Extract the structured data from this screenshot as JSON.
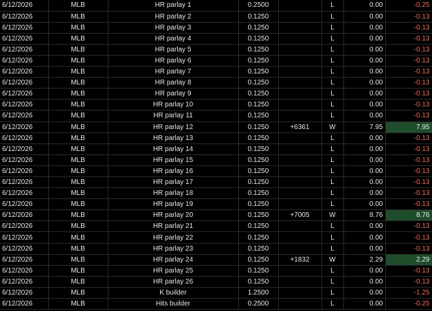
{
  "colors": {
    "background": "#000000",
    "text": "#e8e8e8",
    "negative": "#f06b5d",
    "win_highlight": "#1e4d2b",
    "gridline": "#2b2b2b"
  },
  "rows": [
    {
      "date": "6/12/2026",
      "league": "MLB",
      "bet": "HR parlay 1",
      "stake": "0.2500",
      "odds": "",
      "result": "L",
      "payout": "0.00",
      "net": "-0.25",
      "win": false
    },
    {
      "date": "6/12/2026",
      "league": "MLB",
      "bet": "HR parlay 2",
      "stake": "0.1250",
      "odds": "",
      "result": "L",
      "payout": "0.00",
      "net": "-0.13",
      "win": false
    },
    {
      "date": "6/12/2026",
      "league": "MLB",
      "bet": "HR parlay 3",
      "stake": "0.1250",
      "odds": "",
      "result": "L",
      "payout": "0.00",
      "net": "-0.13",
      "win": false
    },
    {
      "date": "6/12/2026",
      "league": "MLB",
      "bet": "HR parlay 4",
      "stake": "0.1250",
      "odds": "",
      "result": "L",
      "payout": "0.00",
      "net": "-0.13",
      "win": false
    },
    {
      "date": "6/12/2026",
      "league": "MLB",
      "bet": "HR parlay 5",
      "stake": "0.1250",
      "odds": "",
      "result": "L",
      "payout": "0.00",
      "net": "-0.13",
      "win": false
    },
    {
      "date": "6/12/2026",
      "league": "MLB",
      "bet": "HR parlay 6",
      "stake": "0.1250",
      "odds": "",
      "result": "L",
      "payout": "0.00",
      "net": "-0.13",
      "win": false
    },
    {
      "date": "6/12/2026",
      "league": "MLB",
      "bet": "HR parlay 7",
      "stake": "0.1250",
      "odds": "",
      "result": "L",
      "payout": "0.00",
      "net": "-0.13",
      "win": false
    },
    {
      "date": "6/12/2026",
      "league": "MLB",
      "bet": "HR parlay 8",
      "stake": "0.1250",
      "odds": "",
      "result": "L",
      "payout": "0.00",
      "net": "-0.13",
      "win": false
    },
    {
      "date": "6/12/2026",
      "league": "MLB",
      "bet": "HR parlay 9",
      "stake": "0.1250",
      "odds": "",
      "result": "L",
      "payout": "0.00",
      "net": "-0.13",
      "win": false
    },
    {
      "date": "6/12/2026",
      "league": "MLB",
      "bet": "HR parlay 10",
      "stake": "0.1250",
      "odds": "",
      "result": "L",
      "payout": "0.00",
      "net": "-0.13",
      "win": false
    },
    {
      "date": "6/12/2026",
      "league": "MLB",
      "bet": "HR parlay 11",
      "stake": "0.1250",
      "odds": "",
      "result": "L",
      "payout": "0.00",
      "net": "-0.13",
      "win": false
    },
    {
      "date": "6/12/2026",
      "league": "MLB",
      "bet": "HR parlay 12",
      "stake": "0.1250",
      "odds": "+6361",
      "result": "W",
      "payout": "7.95",
      "net": "7.95",
      "win": true
    },
    {
      "date": "6/12/2026",
      "league": "MLB",
      "bet": "HR parlay 13",
      "stake": "0.1250",
      "odds": "",
      "result": "L",
      "payout": "0.00",
      "net": "-0.13",
      "win": false
    },
    {
      "date": "6/12/2026",
      "league": "MLB",
      "bet": "HR parlay 14",
      "stake": "0.1250",
      "odds": "",
      "result": "L",
      "payout": "0.00",
      "net": "-0.13",
      "win": false
    },
    {
      "date": "6/12/2026",
      "league": "MLB",
      "bet": "HR parlay 15",
      "stake": "0.1250",
      "odds": "",
      "result": "L",
      "payout": "0.00",
      "net": "-0.13",
      "win": false
    },
    {
      "date": "6/12/2026",
      "league": "MLB",
      "bet": "HR parlay 16",
      "stake": "0.1250",
      "odds": "",
      "result": "L",
      "payout": "0.00",
      "net": "-0.13",
      "win": false
    },
    {
      "date": "6/12/2026",
      "league": "MLB",
      "bet": "HR parlay 17",
      "stake": "0.1250",
      "odds": "",
      "result": "L",
      "payout": "0.00",
      "net": "-0.13",
      "win": false
    },
    {
      "date": "6/12/2026",
      "league": "MLB",
      "bet": "HR parlay 18",
      "stake": "0.1250",
      "odds": "",
      "result": "L",
      "payout": "0.00",
      "net": "-0.13",
      "win": false
    },
    {
      "date": "6/12/2026",
      "league": "MLB",
      "bet": "HR parlay 19",
      "stake": "0.1250",
      "odds": "",
      "result": "L",
      "payout": "0.00",
      "net": "-0.13",
      "win": false
    },
    {
      "date": "6/12/2026",
      "league": "MLB",
      "bet": "HR parlay 20",
      "stake": "0.1250",
      "odds": "+7005",
      "result": "W",
      "payout": "8.76",
      "net": "8.76",
      "win": true
    },
    {
      "date": "6/12/2026",
      "league": "MLB",
      "bet": "HR parlay 21",
      "stake": "0.1250",
      "odds": "",
      "result": "L",
      "payout": "0.00",
      "net": "-0.13",
      "win": false
    },
    {
      "date": "6/12/2026",
      "league": "MLB",
      "bet": "HR parlay 22",
      "stake": "0.1250",
      "odds": "",
      "result": "L",
      "payout": "0.00",
      "net": "-0.13",
      "win": false
    },
    {
      "date": "6/12/2026",
      "league": "MLB",
      "bet": "HR parlay 23",
      "stake": "0.1250",
      "odds": "",
      "result": "L",
      "payout": "0.00",
      "net": "-0.13",
      "win": false
    },
    {
      "date": "6/12/2026",
      "league": "MLB",
      "bet": "HR parlay 24",
      "stake": "0.1250",
      "odds": "+1832",
      "result": "W",
      "payout": "2.29",
      "net": "2.29",
      "win": true
    },
    {
      "date": "6/12/2026",
      "league": "MLB",
      "bet": "HR parlay 25",
      "stake": "0.1250",
      "odds": "",
      "result": "L",
      "payout": "0.00",
      "net": "-0.13",
      "win": false
    },
    {
      "date": "6/12/2026",
      "league": "MLB",
      "bet": "HR parlay 26",
      "stake": "0.1250",
      "odds": "",
      "result": "L",
      "payout": "0.00",
      "net": "-0.13",
      "win": false
    },
    {
      "date": "6/12/2026",
      "league": "MLB",
      "bet": "K builder",
      "stake": "1.2500",
      "odds": "",
      "result": "L",
      "payout": "0.00",
      "net": "-1.25",
      "win": false
    },
    {
      "date": "6/12/2026",
      "league": "MLB",
      "bet": "Hits builder",
      "stake": "0.2500",
      "odds": "",
      "result": "L",
      "payout": "0.00",
      "net": "-0.25",
      "win": false
    }
  ]
}
